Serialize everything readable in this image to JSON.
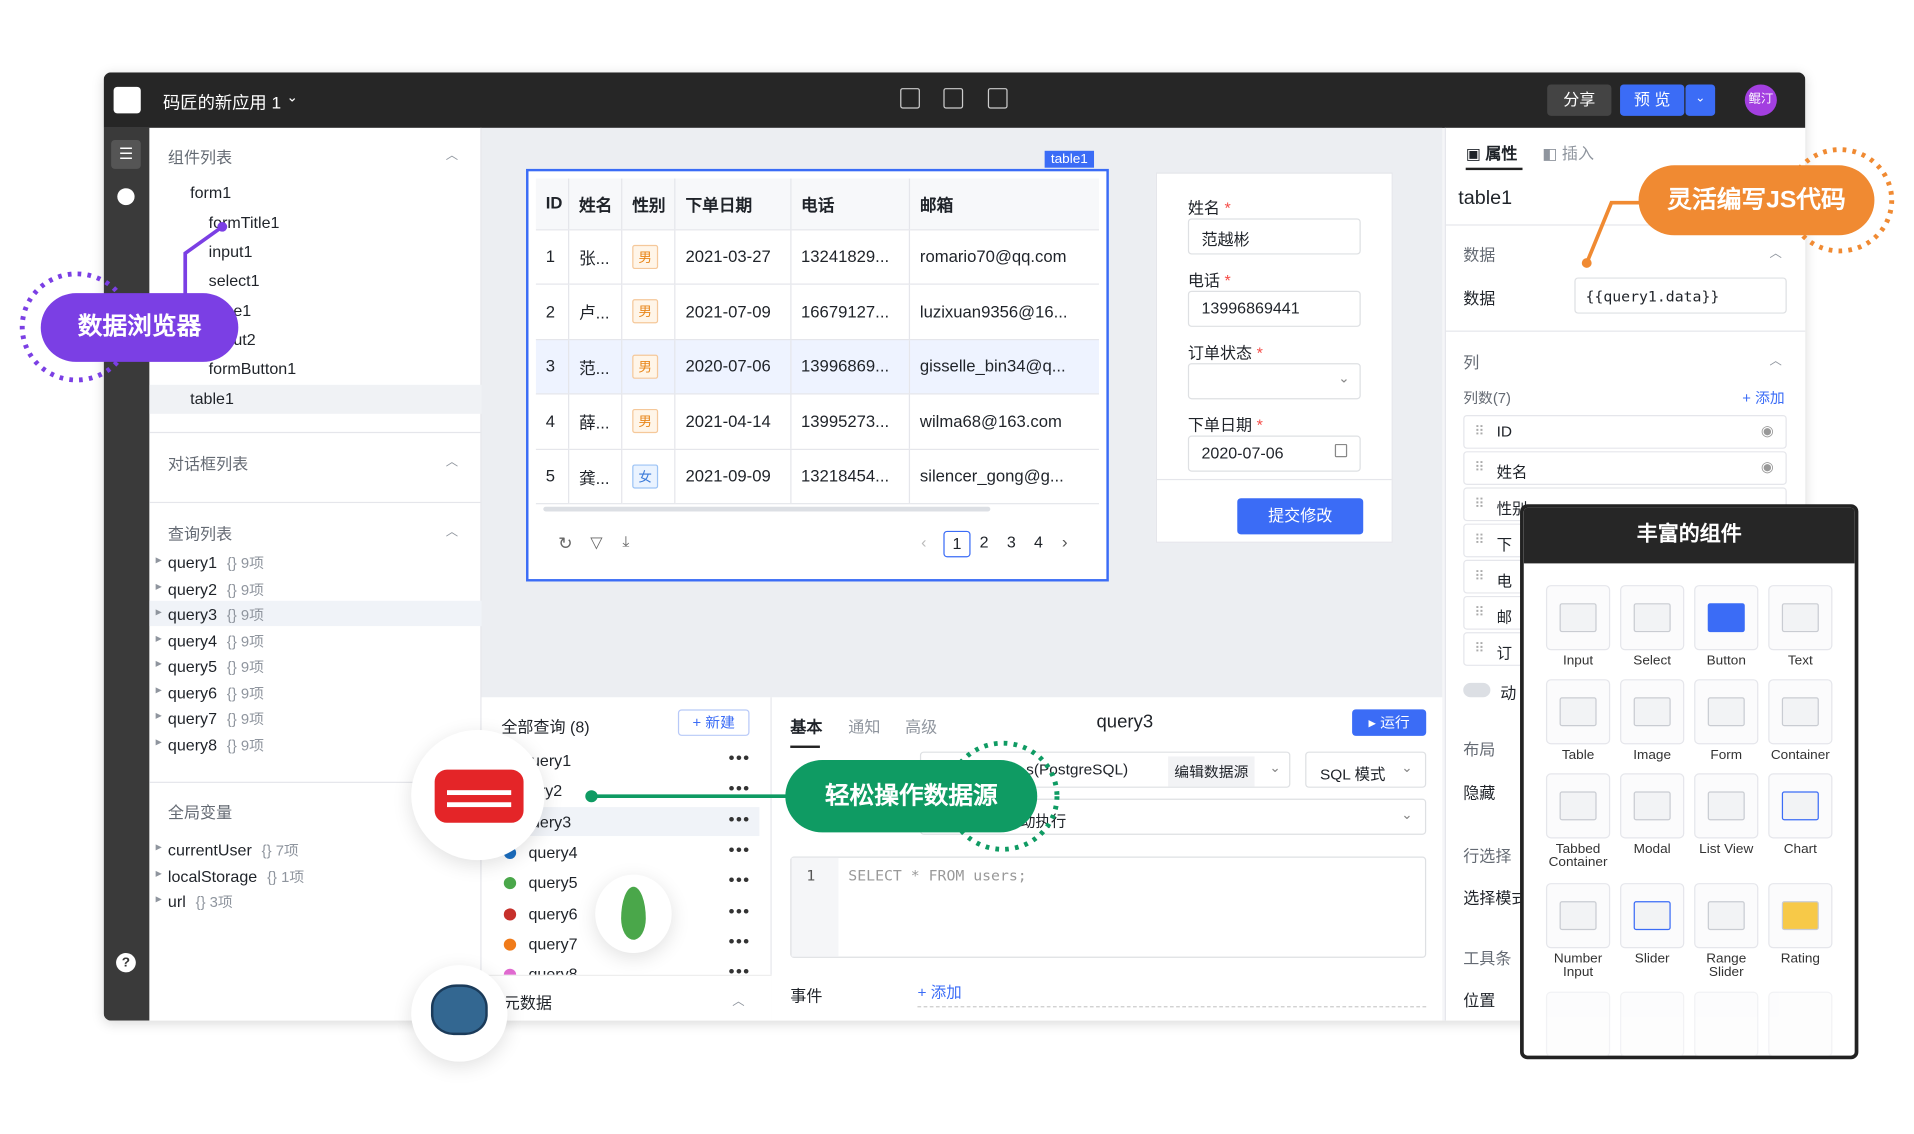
{
  "topbar": {
    "app_title": "码匠的新应用 1",
    "share": "分享",
    "preview": "预 览",
    "avatar": "鲲汀"
  },
  "left": {
    "components_title": "组件列表",
    "tree": [
      "form1",
      "formTitle1",
      "input1",
      "select1",
      "e1",
      "ut2",
      "formButton1",
      "table1"
    ],
    "dialogs_title": "对话框列表",
    "queries_title": "查询列表",
    "queries": [
      {
        "name": "query1",
        "meta": "{} 9项"
      },
      {
        "name": "query2",
        "meta": "{} 9项"
      },
      {
        "name": "query3",
        "meta": "{} 9项"
      },
      {
        "name": "query4",
        "meta": "{} 9项"
      },
      {
        "name": "query5",
        "meta": "{} 9项"
      },
      {
        "name": "query6",
        "meta": "{} 9项"
      },
      {
        "name": "query7",
        "meta": "{} 9项"
      },
      {
        "name": "query8",
        "meta": "{} 9项"
      }
    ],
    "globals_title": "全局变量",
    "globals": [
      {
        "name": "currentUser",
        "meta": "{} 7项"
      },
      {
        "name": "localStorage",
        "meta": "{} 1项"
      },
      {
        "name": "url",
        "meta": "{} 3项"
      }
    ]
  },
  "table": {
    "badge": "table1",
    "headers": [
      "ID",
      "姓名",
      "性别",
      "下单日期",
      "电话",
      "邮箱"
    ],
    "rows": [
      [
        "1",
        "张...",
        "男",
        "2021-03-27",
        "13241829...",
        "romario70@qq.com"
      ],
      [
        "2",
        "卢...",
        "男",
        "2021-07-09",
        "16679127...",
        "luzixuan9356@16..."
      ],
      [
        "3",
        "范...",
        "男",
        "2020-07-06",
        "13996869...",
        "gisselle_bin34@q..."
      ],
      [
        "4",
        "薛...",
        "男",
        "2021-04-14",
        "13995273...",
        "wilma68@163.com"
      ],
      [
        "5",
        "龚...",
        "女",
        "2021-09-09",
        "13218454...",
        "silencer_gong@g..."
      ]
    ],
    "pages": [
      "1",
      "2",
      "3",
      "4"
    ],
    "current_page": 1
  },
  "form": {
    "name_label": "姓名",
    "name_value": "范越彬",
    "phone_label": "电话",
    "phone_value": "13996869441",
    "status_label": "订单状态",
    "status_value": "",
    "date_label": "下单日期",
    "date_value": "2020-07-06",
    "submit": "提交修改"
  },
  "queries_panel": {
    "title": "全部查询 (8)",
    "new": "+ 新建",
    "items": [
      "uery1",
      "ery2",
      "uery3",
      "query4",
      "query5",
      "query6",
      "query7",
      "query8"
    ],
    "meta_section": "元数据"
  },
  "editor": {
    "tabs": [
      "基本",
      "通知",
      "高级"
    ],
    "active_tab": "基本",
    "query_name": "query3",
    "run": "运行",
    "datasource": "s(PostgreSQL)",
    "edit_ds": "编辑数据源",
    "mode": "SQL 模式",
    "trigger": "动执行",
    "line": "1",
    "code": "SELECT * FROM users;",
    "events_label": "事件",
    "add": "+ 添加"
  },
  "right": {
    "tabs": [
      "属性",
      "插入"
    ],
    "component": "table1",
    "data_section": "数据",
    "data_label": "数据",
    "data_value": "{{query1.data}}",
    "cols_section": "列",
    "cols_count": "列数(7)",
    "add": "+ 添加",
    "columns": [
      "ID",
      "姓名",
      "性别",
      "下",
      "电",
      "邮",
      "订"
    ],
    "dyn": "动",
    "layout": "布局",
    "hide": "隐藏",
    "rowsel": "行选择",
    "selmode": "选择模式",
    "toolbar": "工具条",
    "pos": "位置"
  },
  "widgets": {
    "title": "丰富的组件",
    "items": [
      "Input",
      "Select",
      "Button",
      "Text",
      "Table",
      "Image",
      "Form",
      "Container",
      "Tabbed Container",
      "Modal",
      "List View",
      "Chart",
      "Number Input",
      "Slider",
      "Range Slider",
      "Rating"
    ]
  },
  "callouts": {
    "browser": "数据浏览器",
    "js": "灵活编写JS代码",
    "datasource": "轻松操作数据源"
  },
  "colors": {
    "accent": "#3b6cf6",
    "purple": "#7b3fe4",
    "orange": "#f08a32",
    "green": "#0f9b63"
  }
}
